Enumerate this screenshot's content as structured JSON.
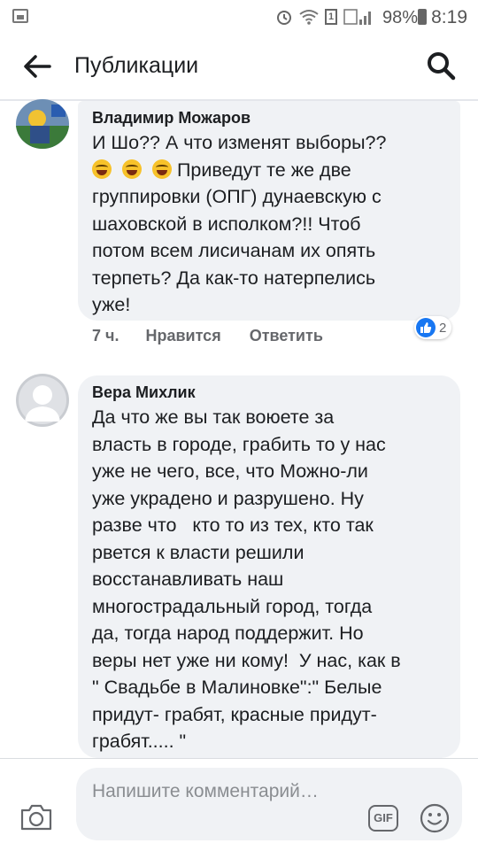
{
  "status_bar": {
    "sim_label": "1",
    "battery": "98%",
    "time": "8:19"
  },
  "header": {
    "title": "Публикации"
  },
  "comments": [
    {
      "author": "Владимир Можаров",
      "text_line1": "И Шо?? А что изменят выборы??",
      "text_line2": "Приведут те же две",
      "text_rest": "группировки (ОПГ) дунаевскую с\nшаховской в исполком?!! Чтоб\nпотом всем лисичанам их опять\nтерпеть? Да как-то натерпелись\nуже!",
      "time": "7 ч.",
      "like_label": "Нравится",
      "reply_label": "Ответить",
      "reaction_count": "2"
    },
    {
      "author": "Вера Михлик",
      "text": "Да что же вы так воюете за\nвласть в городе, грабить то у нас\nуже не чего, все, что Можно-ли\nуже украдено и разрушено. Ну\nразве что   кто то из тех, кто так\nрвется к власти решили\nвосстанавливать наш\nмногострадальный город, тогда\nда, тогда народ поддержит. Но\nверы нет уже ни кому!  У нас, как в\n\" Свадьбе в Малиновке\":\" Белые\nпридут- грабят, красные придут-\nграбят..... \""
    }
  ],
  "composer": {
    "placeholder": "Напишите комментарий…",
    "gif_label": "GIF"
  }
}
